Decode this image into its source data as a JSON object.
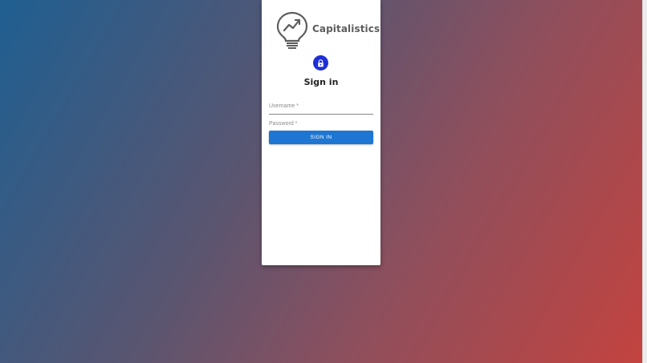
{
  "brand": {
    "name": "Capitalistics",
    "logo_icon": "lightbulb-chart-icon",
    "text_color": "#5d5d5d"
  },
  "login": {
    "lock_icon": "lock-icon",
    "title": "Sign in",
    "username_label": "Username *",
    "password_label": "Password *",
    "submit_label": "SIGN IN"
  },
  "colors": {
    "accent": "#1d76d2",
    "avatar": "#1f2fd6",
    "gradient_start": "#1f5f91",
    "gradient_end": "#c3433f"
  }
}
